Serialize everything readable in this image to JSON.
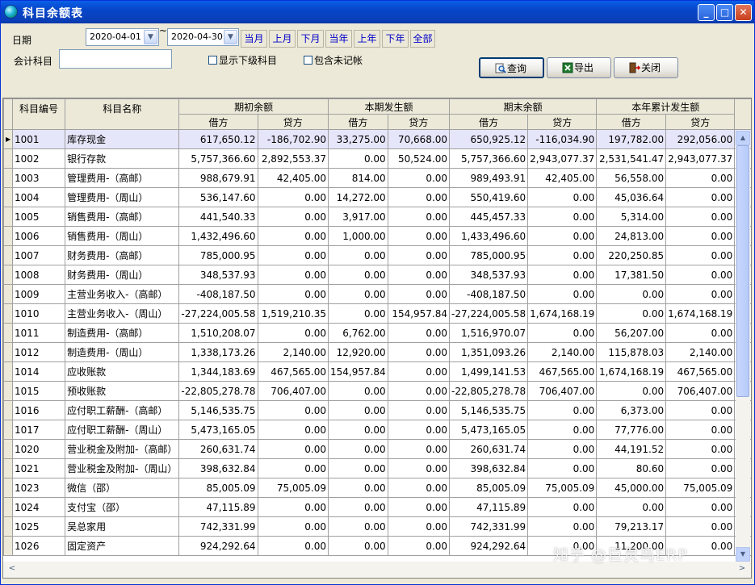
{
  "window": {
    "title": "科目余额表",
    "minimize": "_",
    "maximize": "□",
    "close": "✕"
  },
  "filters": {
    "date_label": "日期",
    "date_from": "2020-04-01",
    "tilde": "~",
    "date_to": "2020-04-30",
    "period_buttons": [
      "当月",
      "上月",
      "下月",
      "当年",
      "上年",
      "下年",
      "全部"
    ],
    "account_label": "会计科目",
    "account_value": "",
    "show_sub_label": "显示下级科目",
    "show_sub_checked": false,
    "include_unposted_label": "包含未记帐",
    "include_unposted_checked": false
  },
  "actions": {
    "query": "查询",
    "export": "导出",
    "close": "关闭"
  },
  "table": {
    "headers": {
      "code": "科目编号",
      "name": "科目名称",
      "groups": [
        "期初余额",
        "本期发生额",
        "期末余额",
        "本年累计发生额"
      ],
      "debit": "借方",
      "credit": "贷方"
    },
    "rows": [
      [
        "1001",
        "库存现金",
        "617,650.12",
        "-186,702.90",
        "33,275.00",
        "70,668.00",
        "650,925.12",
        "-116,034.90",
        "197,782.00",
        "292,056.00"
      ],
      [
        "1002",
        "银行存款",
        "5,757,366.60",
        "2,892,553.37",
        "0.00",
        "50,524.00",
        "5,757,366.60",
        "2,943,077.37",
        "2,531,541.47",
        "2,943,077.37"
      ],
      [
        "1003",
        "管理费用-（高邮）",
        "988,679.91",
        "42,405.00",
        "814.00",
        "0.00",
        "989,493.91",
        "42,405.00",
        "56,558.00",
        "0.00"
      ],
      [
        "1004",
        "管理费用-（周山）",
        "536,147.60",
        "0.00",
        "14,272.00",
        "0.00",
        "550,419.60",
        "0.00",
        "45,036.64",
        "0.00"
      ],
      [
        "1005",
        "销售费用-（高邮）",
        "441,540.33",
        "0.00",
        "3,917.00",
        "0.00",
        "445,457.33",
        "0.00",
        "5,314.00",
        "0.00"
      ],
      [
        "1006",
        "销售费用-（周山）",
        "1,432,496.60",
        "0.00",
        "1,000.00",
        "0.00",
        "1,433,496.60",
        "0.00",
        "24,813.00",
        "0.00"
      ],
      [
        "1007",
        "财务费用-（高邮）",
        "785,000.95",
        "0.00",
        "0.00",
        "0.00",
        "785,000.95",
        "0.00",
        "220,250.85",
        "0.00"
      ],
      [
        "1008",
        "财务费用-（周山）",
        "348,537.93",
        "0.00",
        "0.00",
        "0.00",
        "348,537.93",
        "0.00",
        "17,381.50",
        "0.00"
      ],
      [
        "1009",
        "主营业务收入-（高邮）",
        "-408,187.50",
        "0.00",
        "0.00",
        "0.00",
        "-408,187.50",
        "0.00",
        "0.00",
        "0.00"
      ],
      [
        "1010",
        "主营业务收入-（周山）",
        "-27,224,005.58",
        "1,519,210.35",
        "0.00",
        "154,957.84",
        "-27,224,005.58",
        "1,674,168.19",
        "0.00",
        "1,674,168.19"
      ],
      [
        "1011",
        "制造费用-（高邮）",
        "1,510,208.07",
        "0.00",
        "6,762.00",
        "0.00",
        "1,516,970.07",
        "0.00",
        "56,207.00",
        "0.00"
      ],
      [
        "1012",
        "制造费用-（周山）",
        "1,338,173.26",
        "2,140.00",
        "12,920.00",
        "0.00",
        "1,351,093.26",
        "2,140.00",
        "115,878.03",
        "2,140.00"
      ],
      [
        "1014",
        "应收账款",
        "1,344,183.69",
        "467,565.00",
        "154,957.84",
        "0.00",
        "1,499,141.53",
        "467,565.00",
        "1,674,168.19",
        "467,565.00"
      ],
      [
        "1015",
        "预收账款",
        "-22,805,278.78",
        "706,407.00",
        "0.00",
        "0.00",
        "-22,805,278.78",
        "706,407.00",
        "0.00",
        "706,407.00"
      ],
      [
        "1016",
        "应付职工薪酬-（高邮）",
        "5,146,535.75",
        "0.00",
        "0.00",
        "0.00",
        "5,146,535.75",
        "0.00",
        "6,373.00",
        "0.00"
      ],
      [
        "1017",
        "应付职工薪酬-（周山）",
        "5,473,165.05",
        "0.00",
        "0.00",
        "0.00",
        "5,473,165.05",
        "0.00",
        "77,776.00",
        "0.00"
      ],
      [
        "1020",
        "营业税金及附加-（高邮）",
        "260,631.74",
        "0.00",
        "0.00",
        "0.00",
        "260,631.74",
        "0.00",
        "44,191.52",
        "0.00"
      ],
      [
        "1021",
        "营业税金及附加-（周山）",
        "398,632.84",
        "0.00",
        "0.00",
        "0.00",
        "398,632.84",
        "0.00",
        "80.60",
        "0.00"
      ],
      [
        "1023",
        "微信（邵）",
        "85,005.09",
        "75,005.09",
        "0.00",
        "0.00",
        "85,005.09",
        "75,005.09",
        "45,000.00",
        "75,005.09"
      ],
      [
        "1024",
        "支付宝（邵）",
        "47,115.89",
        "0.00",
        "0.00",
        "0.00",
        "47,115.89",
        "0.00",
        "0.00",
        "0.00"
      ],
      [
        "1025",
        "吴总家用",
        "742,331.99",
        "0.00",
        "0.00",
        "0.00",
        "742,331.99",
        "0.00",
        "79,213.17",
        "0.00"
      ],
      [
        "1026",
        "固定资产",
        "924,292.64",
        "0.00",
        "0.00",
        "0.00",
        "924,292.64",
        "0.00",
        "11,200.00",
        "0.00"
      ]
    ]
  },
  "watermark": "知乎 @巨灵鸟ERP"
}
